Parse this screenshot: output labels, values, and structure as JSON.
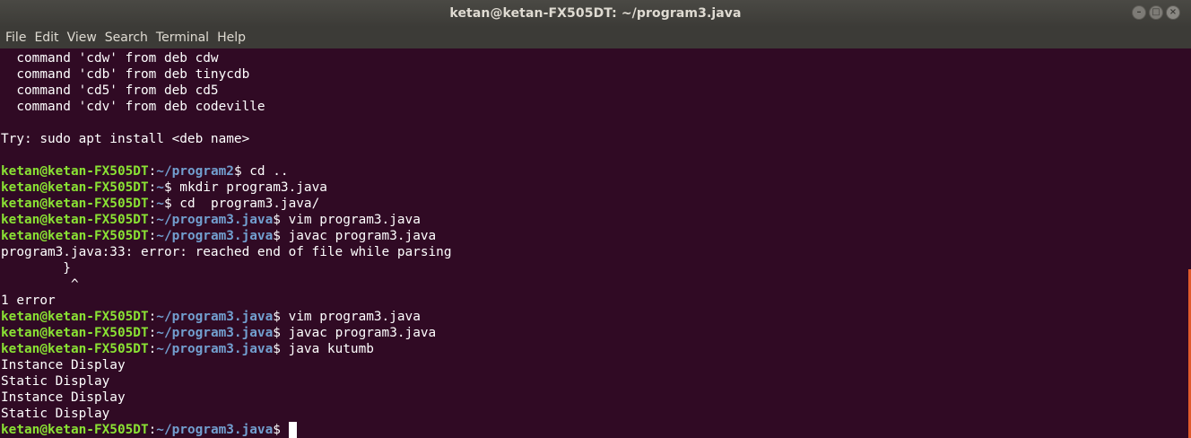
{
  "window": {
    "title": "ketan@ketan-FX505DT: ~/program3.java",
    "controls": {
      "minimize_icon": "minimize-icon",
      "maximize_icon": "maximize-icon",
      "close_icon": "close-icon"
    }
  },
  "menubar": {
    "items": [
      "File",
      "Edit",
      "View",
      "Search",
      "Terminal",
      "Help"
    ]
  },
  "colors": {
    "background": "#300a24",
    "prompt_user": "#8ae234",
    "prompt_path": "#729fcf",
    "text": "#ffffff"
  },
  "terminal": {
    "lines": [
      {
        "text": "  command 'cdw' from deb cdw"
      },
      {
        "text": "  command 'cdb' from deb tinycdb"
      },
      {
        "text": "  command 'cd5' from deb cd5"
      },
      {
        "text": "  command 'cdv' from deb codeville"
      },
      {
        "text": ""
      },
      {
        "text": "Try: sudo apt install <deb name>"
      },
      {
        "text": ""
      },
      {
        "user": "ketan@ketan-FX505DT",
        "path": "~/program2",
        "cmd": "$ cd .."
      },
      {
        "user": "ketan@ketan-FX505DT",
        "path": "~",
        "cmd": "$ mkdir program3.java"
      },
      {
        "user": "ketan@ketan-FX505DT",
        "path": "~",
        "cmd": "$ cd  program3.java/"
      },
      {
        "user": "ketan@ketan-FX505DT",
        "path": "~/program3.java",
        "cmd": "$ vim program3.java"
      },
      {
        "user": "ketan@ketan-FX505DT",
        "path": "~/program3.java",
        "cmd": "$ javac program3.java"
      },
      {
        "text": "program3.java:33: error: reached end of file while parsing"
      },
      {
        "text": "        }"
      },
      {
        "text": "         ^"
      },
      {
        "text": "1 error"
      },
      {
        "user": "ketan@ketan-FX505DT",
        "path": "~/program3.java",
        "cmd": "$ vim program3.java"
      },
      {
        "user": "ketan@ketan-FX505DT",
        "path": "~/program3.java",
        "cmd": "$ javac program3.java"
      },
      {
        "user": "ketan@ketan-FX505DT",
        "path": "~/program3.java",
        "cmd": "$ java kutumb"
      },
      {
        "text": "Instance Display"
      },
      {
        "text": "Static Display"
      },
      {
        "text": "Instance Display"
      },
      {
        "text": "Static Display"
      },
      {
        "user": "ketan@ketan-FX505DT",
        "path": "~/program3.java",
        "cmd": "$ ",
        "cursor": true
      }
    ]
  }
}
